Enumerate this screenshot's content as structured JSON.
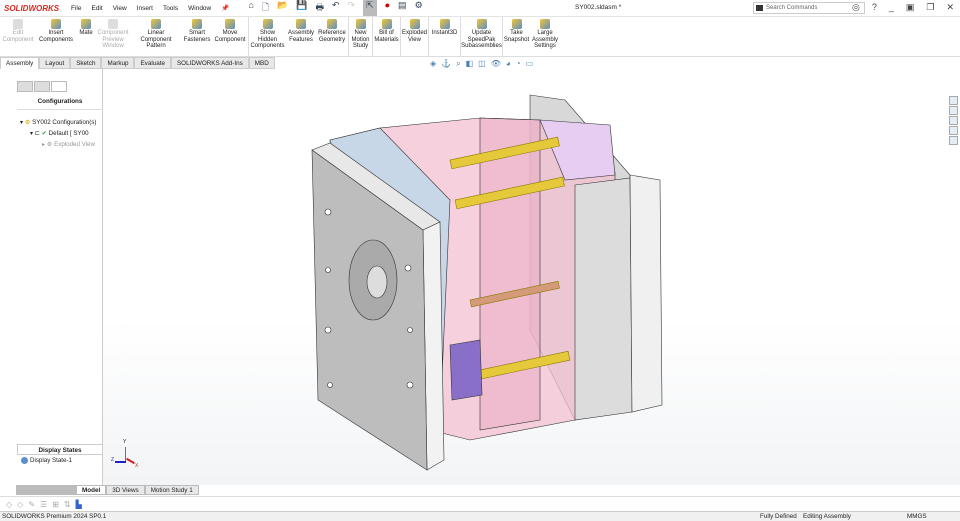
{
  "app": {
    "logo": "SOLIDWORKS",
    "document_title": "SY002.sldasm *"
  },
  "menu": [
    "File",
    "Edit",
    "View",
    "Insert",
    "Tools",
    "Window"
  ],
  "search": {
    "placeholder": "Search Commands"
  },
  "ribbon": [
    {
      "label": "Edit Component",
      "enabled": false
    },
    {
      "label": "Insert Components",
      "enabled": true
    },
    {
      "label": "Mate",
      "enabled": true
    },
    {
      "label": "Component Preview Window",
      "enabled": false
    },
    {
      "label": "Linear Component Pattern",
      "enabled": true
    },
    {
      "label": "Smart Fasteners",
      "enabled": true
    },
    {
      "label": "Move Component",
      "enabled": true
    },
    {
      "label": "Show Hidden Components",
      "enabled": true
    },
    {
      "label": "Assembly Features",
      "enabled": true
    },
    {
      "label": "Reference Geometry",
      "enabled": true
    },
    {
      "label": "New Motion Study",
      "enabled": true
    },
    {
      "label": "Bill of Materials",
      "enabled": true
    },
    {
      "label": "Exploded View",
      "enabled": true
    },
    {
      "label": "Instant3D",
      "enabled": true
    },
    {
      "label": "Update SpeedPak Subassemblies",
      "enabled": true
    },
    {
      "label": "Take Snapshot",
      "enabled": true
    },
    {
      "label": "Large Assembly Settings",
      "enabled": true
    }
  ],
  "tabs": [
    "Assembly",
    "Layout",
    "Sketch",
    "Markup",
    "Evaluate",
    "SOLIDWORKS Add-Ins",
    "MBD"
  ],
  "panel": {
    "title": "Configurations",
    "tree": [
      "SY002 Configuration(s)",
      "Default [ SY00",
      "Exploded View"
    ],
    "display_states_title": "Display States",
    "display_state": "Display State-1"
  },
  "triad": {
    "x": "X",
    "y": "Y",
    "z": "Z"
  },
  "bottom_tabs": [
    "Model",
    "3D Views",
    "Motion Study 1"
  ],
  "status": {
    "product": "SOLIDWORKS Premium 2024 SP0.1",
    "state": "Fully Defined",
    "mode": "Editing Assembly",
    "units": "MMGS"
  }
}
